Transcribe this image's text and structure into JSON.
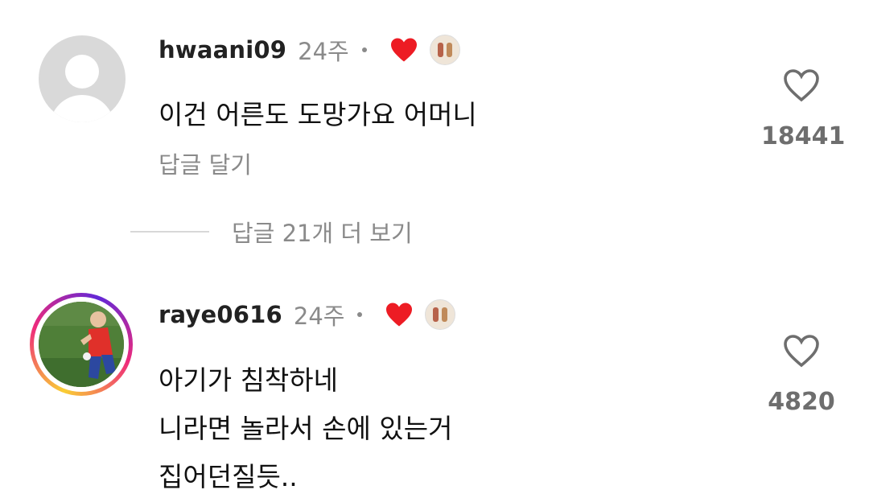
{
  "comments": [
    {
      "username": "hwaani09",
      "time": "24주",
      "text_lines": [
        "이건 어른도 도망가요 어머니"
      ],
      "reply_label": "답글 달기",
      "like_count": "18441",
      "liked_by_creator": true
    },
    {
      "username": "raye0616",
      "time": "24주",
      "text_lines": [
        "아기가 침착하네",
        "니라면 놀라서 손에 있는거",
        "집어던질듯.."
      ],
      "like_count": "4820",
      "liked_by_creator": true
    }
  ],
  "more_replies_label": "답글 21개 더 보기",
  "colors": {
    "heart_red": "#ed1c24",
    "muted_text": "#8a8a8a",
    "story_ring": "#ee2a7b"
  }
}
